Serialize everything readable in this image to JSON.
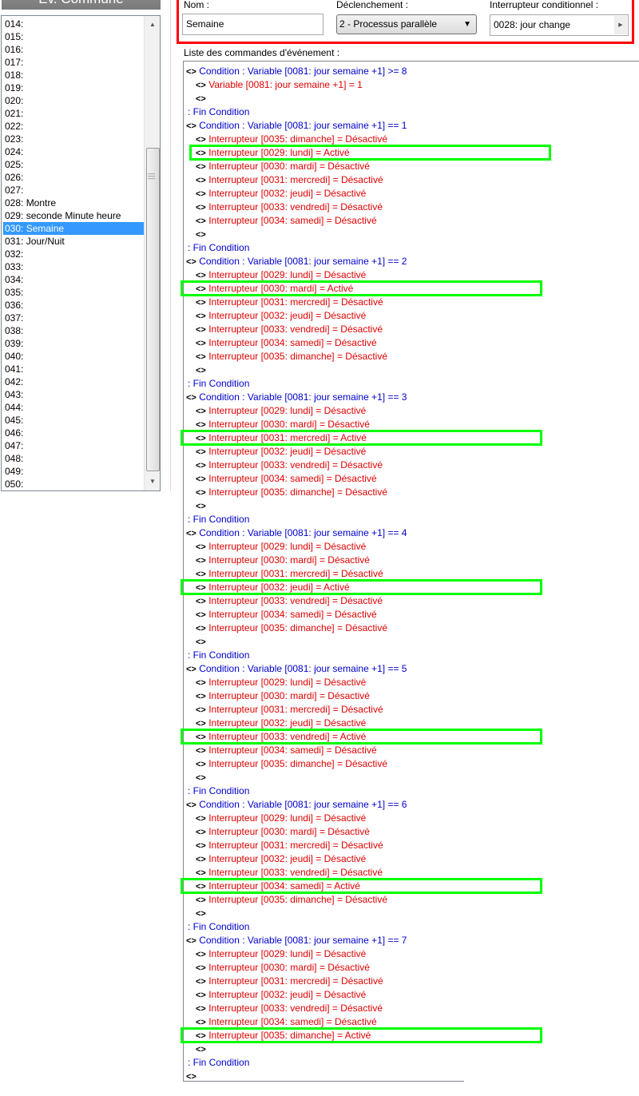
{
  "sidebar": {
    "title": "Ev. Commune",
    "items": [
      {
        "label": "014:"
      },
      {
        "label": "015:"
      },
      {
        "label": "016:"
      },
      {
        "label": "017:"
      },
      {
        "label": "018:"
      },
      {
        "label": "019:"
      },
      {
        "label": "020:"
      },
      {
        "label": "021:"
      },
      {
        "label": "022:"
      },
      {
        "label": "023:"
      },
      {
        "label": "024:"
      },
      {
        "label": "025:"
      },
      {
        "label": "026:"
      },
      {
        "label": "027:"
      },
      {
        "label": "028: Montre"
      },
      {
        "label": "029: seconde Minute heure"
      },
      {
        "label": "030: Semaine",
        "selected": true
      },
      {
        "label": "031: Jour/Nuit"
      },
      {
        "label": "032:"
      },
      {
        "label": "033:"
      },
      {
        "label": "034:"
      },
      {
        "label": "035:"
      },
      {
        "label": "036:"
      },
      {
        "label": "037:"
      },
      {
        "label": "038:"
      },
      {
        "label": "039:"
      },
      {
        "label": "040:"
      },
      {
        "label": "041:"
      },
      {
        "label": "042:"
      },
      {
        "label": "043:"
      },
      {
        "label": "044:"
      },
      {
        "label": "045:"
      },
      {
        "label": "046:"
      },
      {
        "label": "047:"
      },
      {
        "label": "048:"
      },
      {
        "label": "049:"
      },
      {
        "label": "050:"
      }
    ]
  },
  "properties": {
    "name_label": "Nom :",
    "name_value": "Semaine",
    "trigger_label": "Déclenchement :",
    "trigger_value": "2 - Processus parallèle",
    "switch_label": "Interrupteur conditionnel :",
    "switch_value": "0028: jour change"
  },
  "commands": {
    "label": "Liste des commandes d'événement :",
    "marker": "<>",
    "rows": [
      {
        "type": "cond",
        "text": "Condition : Variable [0081: jour semaine +1] >= 8"
      },
      {
        "type": "cmd",
        "text": "Variable [0081: jour semaine +1] = 1"
      },
      {
        "type": "empty"
      },
      {
        "type": "end",
        "text": ":  Fin Condition"
      },
      {
        "type": "cond",
        "text": "Condition : Variable [0081: jour semaine +1] == 1"
      },
      {
        "type": "cmd",
        "text": "Interrupteur [0035: dimanche] = Désactivé"
      },
      {
        "type": "cmd",
        "text": "Interrupteur [0029: lundi] = Activé",
        "highlight": true
      },
      {
        "type": "cmd",
        "text": "Interrupteur [0030: mardi] = Désactivé"
      },
      {
        "type": "cmd",
        "text": "Interrupteur [0031: mercredi] = Désactivé"
      },
      {
        "type": "cmd",
        "text": "Interrupteur [0032: jeudi] = Désactivé"
      },
      {
        "type": "cmd",
        "text": "Interrupteur [0033: vendredi] = Désactivé"
      },
      {
        "type": "cmd",
        "text": "Interrupteur [0034: samedi] = Désactivé"
      },
      {
        "type": "empty"
      },
      {
        "type": "end",
        "text": ":  Fin Condition"
      },
      {
        "type": "cond",
        "text": "Condition : Variable [0081: jour semaine +1] == 2"
      },
      {
        "type": "cmd",
        "text": "Interrupteur [0029: lundi] = Désactivé"
      },
      {
        "type": "cmd",
        "text": "Interrupteur [0030: mardi] = Activé",
        "highlight": true
      },
      {
        "type": "cmd",
        "text": "Interrupteur [0031: mercredi] = Désactivé"
      },
      {
        "type": "cmd",
        "text": "Interrupteur [0032: jeudi] = Désactivé"
      },
      {
        "type": "cmd",
        "text": "Interrupteur [0033: vendredi] = Désactivé"
      },
      {
        "type": "cmd",
        "text": "Interrupteur [0034: samedi] = Désactivé"
      },
      {
        "type": "cmd",
        "text": "Interrupteur [0035: dimanche] = Désactivé"
      },
      {
        "type": "empty"
      },
      {
        "type": "end",
        "text": ":  Fin Condition"
      },
      {
        "type": "cond",
        "text": "Condition : Variable [0081: jour semaine +1] == 3"
      },
      {
        "type": "cmd",
        "text": "Interrupteur [0029: lundi] = Désactivé"
      },
      {
        "type": "cmd",
        "text": "Interrupteur [0030: mardi] = Désactivé"
      },
      {
        "type": "cmd",
        "text": "Interrupteur [0031: mercredi] = Activé",
        "highlight": true
      },
      {
        "type": "cmd",
        "text": "Interrupteur [0032: jeudi] = Désactivé"
      },
      {
        "type": "cmd",
        "text": "Interrupteur [0033: vendredi] = Désactivé"
      },
      {
        "type": "cmd",
        "text": "Interrupteur [0034: samedi] = Désactivé"
      },
      {
        "type": "cmd",
        "text": "Interrupteur [0035: dimanche] = Désactivé"
      },
      {
        "type": "empty"
      },
      {
        "type": "end",
        "text": ":  Fin Condition"
      },
      {
        "type": "cond",
        "text": "Condition : Variable [0081: jour semaine +1] == 4"
      },
      {
        "type": "cmd",
        "text": "Interrupteur [0029: lundi] = Désactivé"
      },
      {
        "type": "cmd",
        "text": "Interrupteur [0030: mardi] = Désactivé"
      },
      {
        "type": "cmd",
        "text": "Interrupteur [0031: mercredi] = Désactivé"
      },
      {
        "type": "cmd",
        "text": "Interrupteur [0032: jeudi] = Activé",
        "highlight": true
      },
      {
        "type": "cmd",
        "text": "Interrupteur [0033: vendredi] = Désactivé"
      },
      {
        "type": "cmd",
        "text": "Interrupteur [0034: samedi] = Désactivé"
      },
      {
        "type": "cmd",
        "text": "Interrupteur [0035: dimanche] = Désactivé"
      },
      {
        "type": "empty"
      },
      {
        "type": "end",
        "text": ":  Fin Condition"
      },
      {
        "type": "cond",
        "text": "Condition : Variable [0081: jour semaine +1] == 5"
      },
      {
        "type": "cmd",
        "text": "Interrupteur [0029: lundi] = Désactivé"
      },
      {
        "type": "cmd",
        "text": "Interrupteur [0030: mardi] = Désactivé"
      },
      {
        "type": "cmd",
        "text": "Interrupteur [0031: mercredi] = Désactivé"
      },
      {
        "type": "cmd",
        "text": "Interrupteur [0032: jeudi] = Désactivé"
      },
      {
        "type": "cmd",
        "text": "Interrupteur [0033: vendredi] = Activé",
        "highlight": true
      },
      {
        "type": "cmd",
        "text": "Interrupteur [0034: samedi] = Désactivé"
      },
      {
        "type": "cmd",
        "text": "Interrupteur [0035: dimanche] = Désactivé"
      },
      {
        "type": "empty"
      },
      {
        "type": "end",
        "text": ":  Fin Condition"
      },
      {
        "type": "cond",
        "text": "Condition : Variable [0081: jour semaine +1] == 6"
      },
      {
        "type": "cmd",
        "text": "Interrupteur [0029: lundi] = Désactivé"
      },
      {
        "type": "cmd",
        "text": "Interrupteur [0030: mardi] = Désactivé"
      },
      {
        "type": "cmd",
        "text": "Interrupteur [0031: mercredi] = Désactivé"
      },
      {
        "type": "cmd",
        "text": "Interrupteur [0032: jeudi] = Désactivé"
      },
      {
        "type": "cmd",
        "text": "Interrupteur [0033: vendredi] = Désactivé"
      },
      {
        "type": "cmd",
        "text": "Interrupteur [0034: samedi] = Activé",
        "highlight": true
      },
      {
        "type": "cmd",
        "text": "Interrupteur [0035: dimanche] = Désactivé"
      },
      {
        "type": "empty"
      },
      {
        "type": "end",
        "text": ":  Fin Condition"
      },
      {
        "type": "cond",
        "text": "Condition : Variable [0081: jour semaine +1] == 7"
      },
      {
        "type": "cmd",
        "text": "Interrupteur [0029: lundi] = Désactivé"
      },
      {
        "type": "cmd",
        "text": "Interrupteur [0030: mardi] = Désactivé"
      },
      {
        "type": "cmd",
        "text": "Interrupteur [0031: mercredi] = Désactivé"
      },
      {
        "type": "cmd",
        "text": "Interrupteur [0032: jeudi] = Désactivé"
      },
      {
        "type": "cmd",
        "text": "Interrupteur [0033: vendredi] = Désactivé"
      },
      {
        "type": "cmd",
        "text": "Interrupteur [0034: samedi] = Désactivé"
      },
      {
        "type": "cmd",
        "text": "Interrupteur [0035: dimanche] = Activé",
        "highlight": true
      },
      {
        "type": "empty"
      },
      {
        "type": "end",
        "text": ":  Fin Condition"
      },
      {
        "type": "root"
      }
    ]
  },
  "colors": {
    "selection": "#3399ff",
    "condition_text": "#0000cc",
    "command_text": "#e00000",
    "highlight_box": "#00ff00",
    "properties_box": "#ff0000"
  }
}
